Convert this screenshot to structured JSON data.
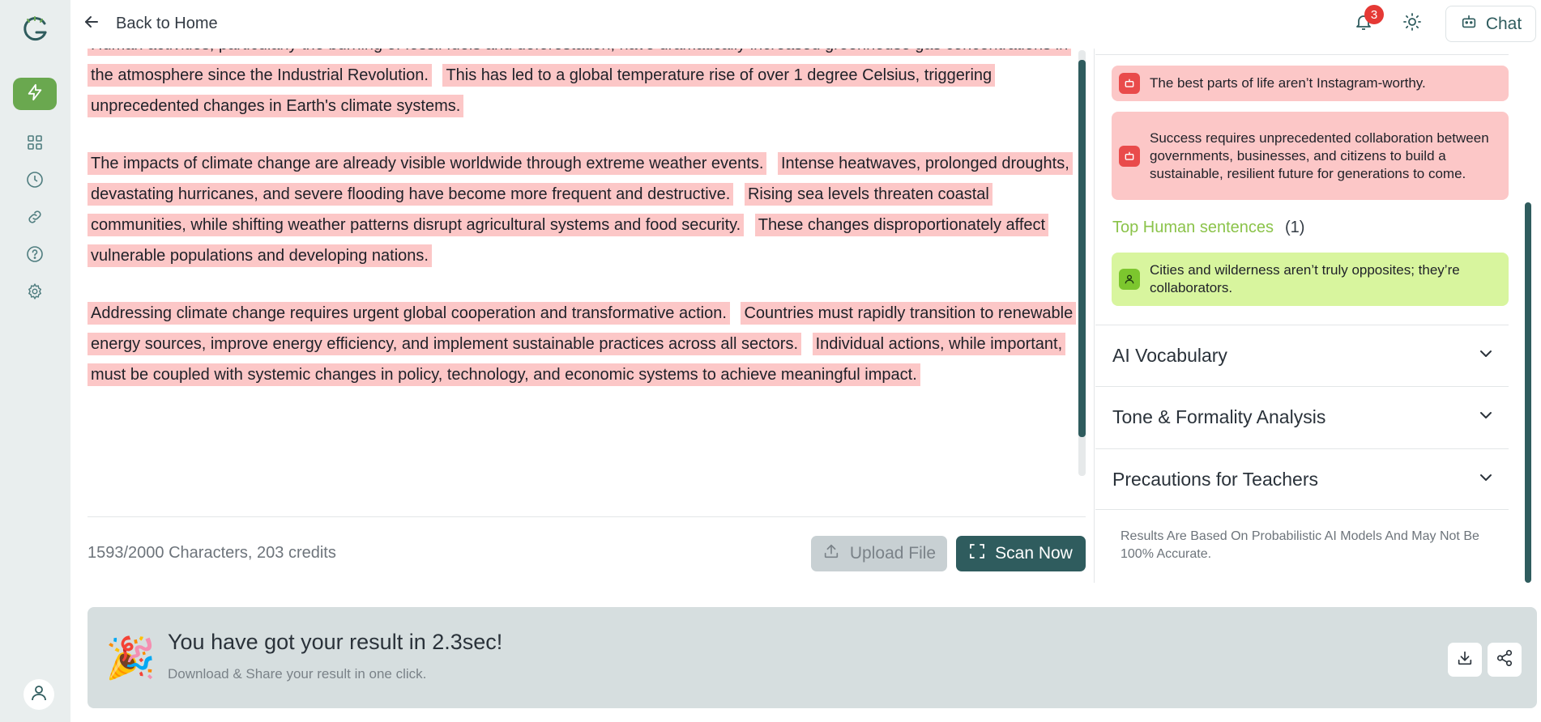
{
  "topbar": {
    "back_label": "Back to Home",
    "notification_count": "3",
    "chat_label": "Chat"
  },
  "editor": {
    "paragraphs": [
      [
        "Human activities, particularly the burning of fossil fuels and deforestation, have dramatically increased greenhouse gas concentrations in the atmosphere since the Industrial Revolution.",
        "This has led to a global temperature rise of over 1 degree Celsius, triggering unprecedented changes in Earth's climate systems."
      ],
      [
        "The impacts of climate change are already visible worldwide through extreme weather events.",
        "Intense heatwaves, prolonged droughts, devastating hurricanes, and severe flooding have become more frequent and destructive.",
        "Rising sea levels threaten coastal communities, while shifting weather patterns disrupt agricultural systems and food security.",
        "These changes disproportionately affect vulnerable populations and developing nations."
      ],
      [
        "Addressing climate change requires urgent global cooperation and transformative action.",
        "Countries must rapidly transition to renewable energy sources, improve energy efficiency, and implement sustainable practices across all sectors.",
        "Individual actions, while important, must be coupled with systemic changes in policy, technology, and economic systems to achieve meaningful impact."
      ]
    ],
    "char_count": "1593/2000 Characters,  203 credits",
    "upload_label": "Upload File",
    "scan_label": "Scan Now"
  },
  "panel": {
    "ai_sentences": [
      "The best parts of life aren’t Instagram-worthy.",
      "Success requires unprecedented collaboration between governments, businesses, and citizens to build a sustainable, resilient future for generations to come."
    ],
    "human_heading": "Top Human sentences",
    "human_count": "(1)",
    "human_sentences": [
      "Cities and wilderness aren’t truly opposites; they’re collaborators."
    ],
    "accordions": [
      "AI Vocabulary",
      "Tone & Formality Analysis",
      "Precautions for Teachers"
    ],
    "disclaimer": "Results Are Based On Probabilistic AI Models And May Not Be 100% Accurate."
  },
  "banner": {
    "emoji": "🎉",
    "title": "You have got your result in 2.3sec!",
    "subtitle": "Download & Share your result in one click."
  },
  "colors": {
    "ai_highlight": "#fcc7c7",
    "human_highlight": "#d8f59e",
    "brand": "#2f5c5e",
    "accent_green": "#6aa84f"
  }
}
